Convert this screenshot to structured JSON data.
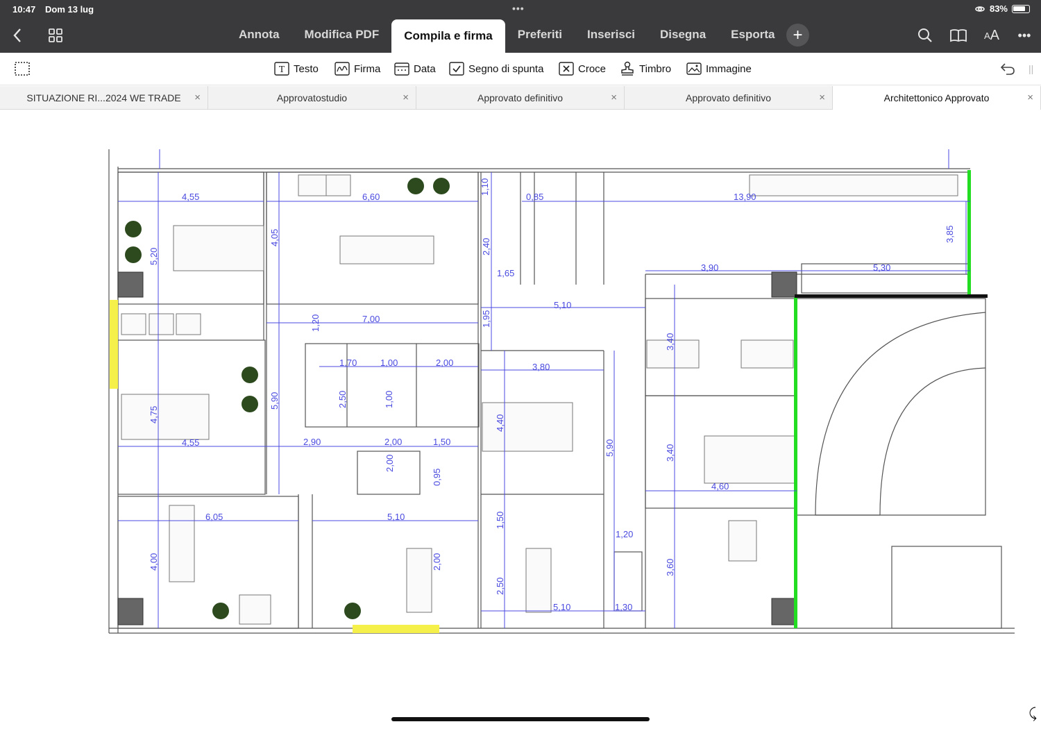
{
  "status": {
    "time": "10:47",
    "date": "Dom 13 lug",
    "battery": "83%",
    "battery_level": 0.83
  },
  "tabs": [
    "Annota",
    "Modifica PDF",
    "Compila e firma",
    "Preferiti",
    "Inserisci",
    "Disegna",
    "Esporta"
  ],
  "active_tab": "Compila e firma",
  "tools": {
    "text": "Testo",
    "signature": "Firma",
    "date": "Data",
    "check": "Segno di spunta",
    "cross": "Croce",
    "stamp": "Timbro",
    "image": "Immagine"
  },
  "documents": [
    "SITUAZIONE RI...2024 WE TRADE",
    "Approvatostudio",
    "Approvato definitivo",
    "Approvato definitivo",
    "Architettonico Approvato"
  ],
  "floorplan": {
    "dimensions": [
      "4,55",
      "6,60",
      "1,10",
      "0,85",
      "13,90",
      "5,20",
      "4,05",
      "2,40",
      "1,65",
      "3,85",
      "3,90",
      "5,30",
      "5,10",
      "7,00",
      "1,20",
      "1,95",
      "1,70",
      "1,00",
      "2,00",
      "2,50",
      "3,80",
      "3,40",
      "1,00",
      "4,75",
      "5,90",
      "4,40",
      "4,55",
      "2,90",
      "2,00",
      "1,50",
      "2,00",
      "0,95",
      "5,90",
      "3,40",
      "4,60",
      "6,05",
      "5,10",
      "1,50",
      "4,00",
      "2,00",
      "1,20",
      "2,50",
      "3,60",
      "5,10",
      "1,30"
    ]
  },
  "colors": {
    "chrome": "#3a3a3c",
    "dimension": "#4a4ae0",
    "green_wall": "#22dd22",
    "yellow": "#f5f04a"
  },
  "icons": [
    "back-icon",
    "grid-icon",
    "plus-icon",
    "search-icon",
    "book-icon",
    "text-size-icon",
    "more-icon",
    "selection-icon",
    "undo-icon"
  ]
}
